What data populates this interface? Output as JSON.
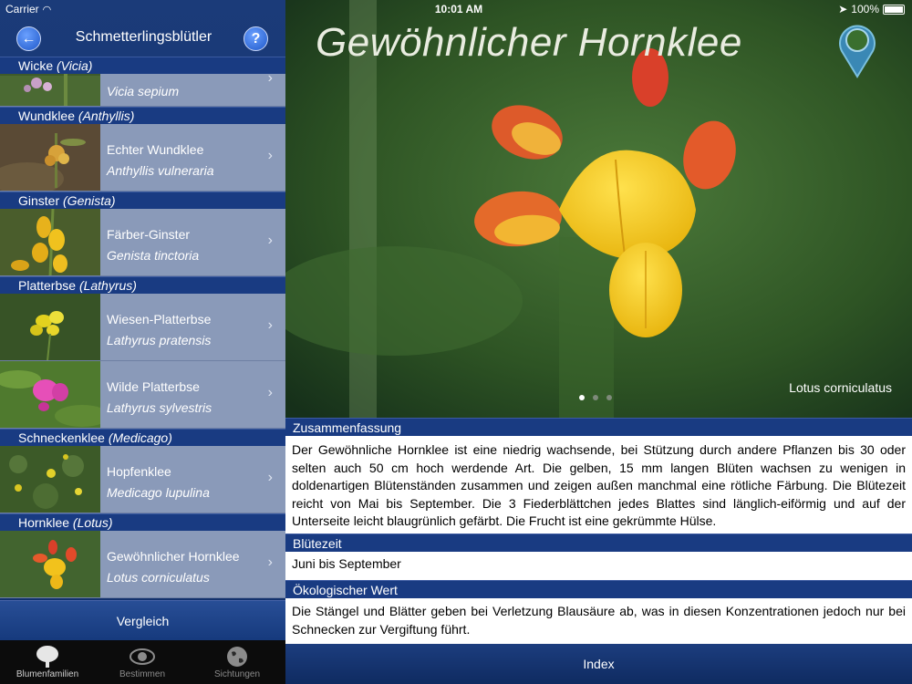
{
  "status": {
    "carrier": "Carrier",
    "time": "10:01 AM",
    "battery": "100%"
  },
  "nav": {
    "back_icon": "back-arrow-icon",
    "title": "Schmetterlingsblütler",
    "help_label": "?"
  },
  "sections": [
    {
      "de": "Wicke",
      "la": "(Vicia)"
    },
    {
      "de": "Wundklee",
      "la": "(Anthyllis)"
    },
    {
      "de": "Ginster",
      "la": "(Genista)"
    },
    {
      "de": "Platterbse",
      "la": "(Lathyrus)"
    },
    {
      "de": "Schneckenklee",
      "la": "(Medicago)"
    },
    {
      "de": "Hornklee",
      "la": "(Lotus)"
    }
  ],
  "species": [
    {
      "de": "",
      "la": "Vicia sepium"
    },
    {
      "de": "Echter Wundklee",
      "la": "Anthyllis vulneraria"
    },
    {
      "de": "Färber-Ginster",
      "la": "Genista tinctoria"
    },
    {
      "de": "Wiesen-Platterbse",
      "la": "Lathyrus pratensis"
    },
    {
      "de": "Wilde Platterbse",
      "la": "Lathyrus sylvestris"
    },
    {
      "de": "Hopfenklee",
      "la": "Medicago lupulina"
    },
    {
      "de": "Gewöhnlicher Hornklee",
      "la": "Lotus corniculatus"
    }
  ],
  "compare_label": "Vergleich",
  "tabs": [
    {
      "label": "Blumenfamilien",
      "icon": "tree-icon"
    },
    {
      "label": "Bestimmen",
      "icon": "eye-icon"
    },
    {
      "label": "Sichtungen",
      "icon": "globe-icon"
    }
  ],
  "detail": {
    "title": "Gewöhnlicher Hornklee",
    "caption": "Lotus corniculatus",
    "map_icon": "map-pin-icon",
    "summary_header": "Zusammenfassung",
    "summary_text": "Der Gewöhnliche Hornklee ist eine niedrig wachsende, bei Stützung durch andere Pflanzen bis 30 oder selten auch 50 cm hoch werdende Art. Die gelben, 15 mm langen Blüten wachsen zu wenigen in doldenartigen Blütenständen zusammen und zeigen außen manchmal eine rötliche Färbung. Die Blütezeit reicht von Mai bis September. Die 3 Fiederblättchen jedes Blattes sind länglich-eiförmig und auf der Unterseite leicht blaugrünlich gefärbt. Die Frucht ist eine gekrümmte Hülse.",
    "bloom_header": "Blütezeit",
    "bloom_text": "Juni bis September",
    "eco_header": "Ökologischer Wert",
    "eco_text": "Die Stängel und Blätter geben bei Verletzung Blausäure ab, was in diesen Konzentrationen jedoch nur bei Schnecken zur Vergiftung führt.",
    "index_label": "Index",
    "slide_count": 3,
    "active_slide": 1
  }
}
